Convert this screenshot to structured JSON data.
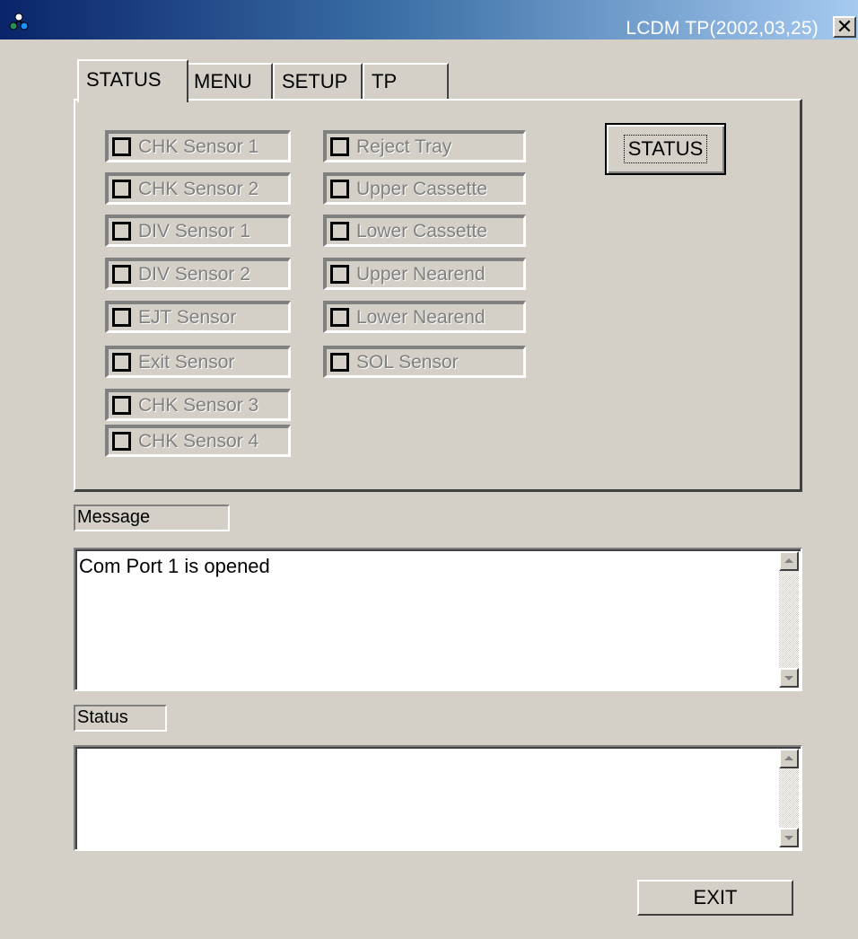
{
  "window": {
    "title": "LCDM TP(2002,03,25)",
    "close_symbol": "✕",
    "icon": "app-network-icon"
  },
  "tabs": [
    {
      "label": "STATUS",
      "active": true
    },
    {
      "label": "MENU",
      "active": false
    },
    {
      "label": "SETUP",
      "active": false
    },
    {
      "label": "TP",
      "active": false
    }
  ],
  "sensors_left": [
    {
      "label": "CHK Sensor 1"
    },
    {
      "label": "CHK Sensor 2"
    },
    {
      "label": "DIV Sensor 1"
    },
    {
      "label": "DIV Sensor 2"
    },
    {
      "label": "EJT Sensor"
    },
    {
      "label": "Exit Sensor"
    },
    {
      "label": "CHK Sensor 3"
    },
    {
      "label": "CHK Sensor 4"
    }
  ],
  "sensors_right": [
    {
      "label": "Reject Tray"
    },
    {
      "label": "Upper Cassette"
    },
    {
      "label": "Lower Cassette"
    },
    {
      "label": "Upper Nearend"
    },
    {
      "label": "Lower Nearend"
    },
    {
      "label": "SOL Sensor"
    }
  ],
  "status_button": {
    "label": "STATUS"
  },
  "message": {
    "label": "Message",
    "text": "Com Port 1 is opened"
  },
  "status": {
    "label": "Status",
    "text": ""
  },
  "exit_button": {
    "label": "EXIT"
  },
  "colors": {
    "face": "#d4d0c8",
    "titlebar_start": "#0a246a",
    "titlebar_end": "#a6caf0",
    "disabled_text": "#808080"
  }
}
